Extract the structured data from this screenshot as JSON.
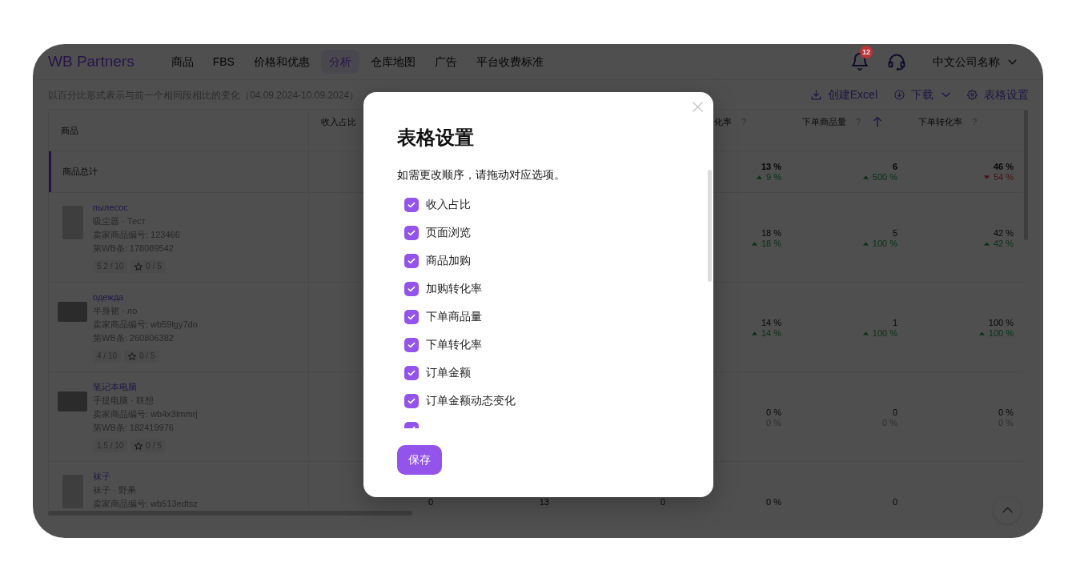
{
  "nav": {
    "logo": "WB Partners",
    "items": [
      {
        "label": "商品",
        "selected": false
      },
      {
        "label": "FBS",
        "selected": false
      },
      {
        "label": "价格和优惠",
        "selected": false
      },
      {
        "label": "分析",
        "selected": true
      },
      {
        "label": "仓库地图",
        "selected": false
      },
      {
        "label": "广告",
        "selected": false
      },
      {
        "label": "平台收费标准",
        "selected": false
      }
    ],
    "notification_count": "12",
    "account": "中文公司名称"
  },
  "toolbar": {
    "period_note": "以百分比形式表示与前一个相同段相比的变化（04.09.2024-10.09.2024）",
    "actions": [
      {
        "kind": "export",
        "label": "创建Excel"
      },
      {
        "kind": "download",
        "label": "下载"
      },
      {
        "kind": "settings",
        "label": "表格设置"
      }
    ]
  },
  "table": {
    "columns": [
      {
        "label": "商品",
        "sorted": false
      },
      {
        "label": "收入占比",
        "sorted": false
      },
      null,
      null,
      {
        "label": "化率",
        "help": "?",
        "sorted": false
      },
      {
        "label": "下单商品量",
        "help": "?",
        "sorted": true
      },
      {
        "label": "下单转化率",
        "help": "?",
        "sorted": false
      }
    ],
    "rows": [
      {
        "kind": "total",
        "label": "商品总计",
        "cells": [
          null,
          null,
          null,
          {
            "value": "13 %",
            "change": "9 %",
            "kind": "rise"
          },
          {
            "value": "6",
            "change": "500 %",
            "kind": "rise"
          },
          {
            "value": "46 %",
            "change": "54 %",
            "kind": "fall"
          }
        ]
      },
      {
        "kind": "product",
        "name": "пылесос",
        "subtitle": "吸尘器 · Тест",
        "vendor_code": "卖家商品编号: 123466",
        "wb_article": "第WB条: 178089542",
        "rating": "5.2 / 10",
        "reviews": "0 / 5",
        "photo": {
          "kind": "portrait"
        },
        "cells": [
          null,
          null,
          null,
          {
            "value": "18 %",
            "change": "18 %",
            "kind": "rise"
          },
          {
            "value": "5",
            "change": "100 %",
            "kind": "rise"
          },
          {
            "value": "42 %",
            "change": "42 %",
            "kind": "rise"
          }
        ]
      },
      {
        "kind": "product",
        "name": "одежда",
        "subtitle": "半身裙 · ло",
        "vendor_code": "卖家商品编号: wb59lgy7do",
        "wb_article": "第WB条: 260806382",
        "rating": "4 / 10",
        "reviews": "0 / 5",
        "photo": {
          "kind": "landscape"
        },
        "cells": [
          null,
          null,
          null,
          {
            "value": "14 %",
            "change": "14 %",
            "kind": "rise"
          },
          {
            "value": "1",
            "change": "100 %",
            "kind": "rise"
          },
          {
            "value": "100 %",
            "change": "100 %",
            "kind": "rise"
          }
        ]
      },
      {
        "kind": "product",
        "name": "笔记本电脑",
        "subtitle": "手提电脑 · 联想",
        "vendor_code": "卖家商品编号: wb4x3lmmrj",
        "wb_article": "第WB条: 182419976",
        "rating": "1.5 / 10",
        "reviews": "0 / 5",
        "photo": {
          "kind": "landscape"
        },
        "cells": [
          null,
          null,
          null,
          {
            "value": "0 %",
            "change": "0 %",
            "kind": "flat"
          },
          {
            "value": "0",
            "change": "0 %",
            "kind": "flat"
          },
          {
            "value": "0 %",
            "change": "0 %",
            "kind": "flat"
          }
        ]
      },
      {
        "kind": "product",
        "name": "袜子",
        "subtitle": "袜子 · 野果",
        "vendor_code": "卖家商品编号: wb513edtsz",
        "photo": {
          "kind": "portrait"
        },
        "cells": [
          {
            "value": "0"
          },
          {
            "value": "13"
          },
          {
            "value": "0"
          },
          {
            "value": "0 %"
          },
          {
            "value": "0"
          },
          null
        ]
      }
    ]
  },
  "modal": {
    "title": "表格设置",
    "hint": "如需更改顺序，请拖动对应选项。",
    "options": [
      {
        "label": "收入占比",
        "checked": true
      },
      {
        "label": "页面浏览",
        "checked": true
      },
      {
        "label": "商品加购",
        "checked": true
      },
      {
        "label": "加购转化率",
        "checked": true
      },
      {
        "label": "下单商品量",
        "checked": true
      },
      {
        "label": "下单转化率",
        "checked": true
      },
      {
        "label": "订单金额",
        "checked": true
      },
      {
        "label": "订单金额动态变化",
        "checked": true
      },
      {
        "checked": true
      }
    ],
    "save": "保存"
  }
}
